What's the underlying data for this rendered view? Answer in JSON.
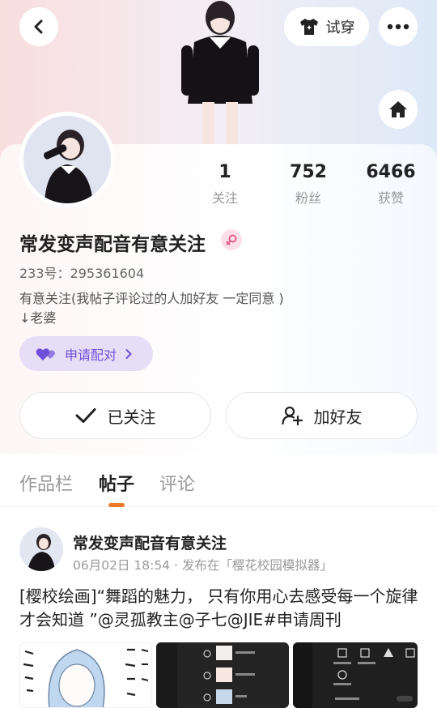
{
  "header": {
    "try_on_label": "试穿",
    "icons": [
      "back-arrow-icon",
      "tshirt-icon",
      "more-dots-icon",
      "home-icon"
    ]
  },
  "profile": {
    "stats": [
      {
        "value": "1",
        "label": "关注"
      },
      {
        "value": "752",
        "label": "粉丝"
      },
      {
        "value": "6466",
        "label": "获赞"
      }
    ],
    "name": "常发变声配音有意关注",
    "gender": "female",
    "id_line": "233号：295361604",
    "bio_lines": [
      "有意关注(我帖子评论过的人加好友 一定同意 )",
      "↓老婆"
    ],
    "match_button": "申请配对",
    "follow_button": "已关注",
    "add_friend_button": "加好友"
  },
  "tabs": [
    {
      "label": "作品栏",
      "active": false
    },
    {
      "label": "帖子",
      "active": true
    },
    {
      "label": "评论",
      "active": false
    }
  ],
  "post": {
    "author": "常发变声配音有意关注",
    "meta": "06月02日 18:54 · 发布在「樱花校园模拟器」",
    "text": "[樱校绘画]“舞蹈的魅力， 只有你用心去感受每一个旋律才会知道 ”@灵孤教主@子七@JIE#申请周刊"
  },
  "colors": {
    "accent": "#f07a2c",
    "match_purple": "#6f4fd8",
    "gender_pink": "#e85d8c"
  }
}
